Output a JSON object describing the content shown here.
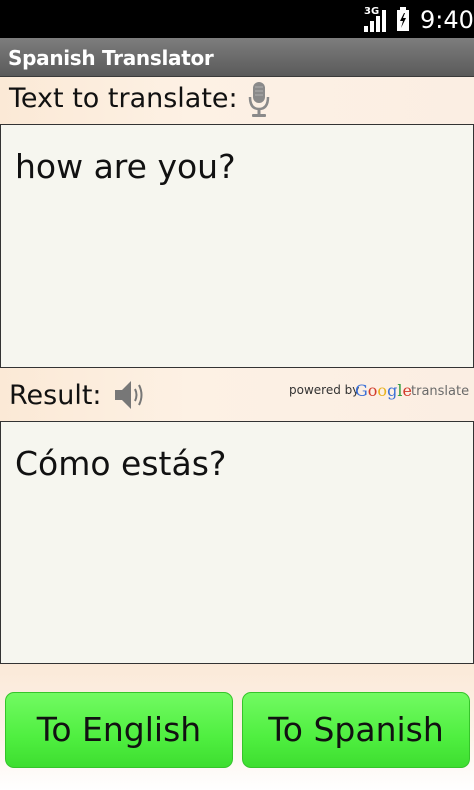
{
  "status_bar": {
    "network": "3G",
    "time": "9:40"
  },
  "app": {
    "title": "Spanish Translator"
  },
  "input_section": {
    "label": "Text to translate:",
    "text": "how are you?"
  },
  "result_section": {
    "label": "Result:",
    "text": "Cómo estás?",
    "attribution": {
      "powered_by": "powered by",
      "google": "Google",
      "translate": "translate"
    }
  },
  "buttons": {
    "to_english": "To English",
    "to_spanish": "To Spanish"
  },
  "colors": {
    "button_green": "#4fef40",
    "label_bar": "#fbe9d6",
    "text_area": "#f6f6ef"
  },
  "icons": {
    "microphone": "microphone-icon",
    "speaker": "speaker-icon",
    "signal": "signal-icon",
    "battery": "battery-icon"
  }
}
